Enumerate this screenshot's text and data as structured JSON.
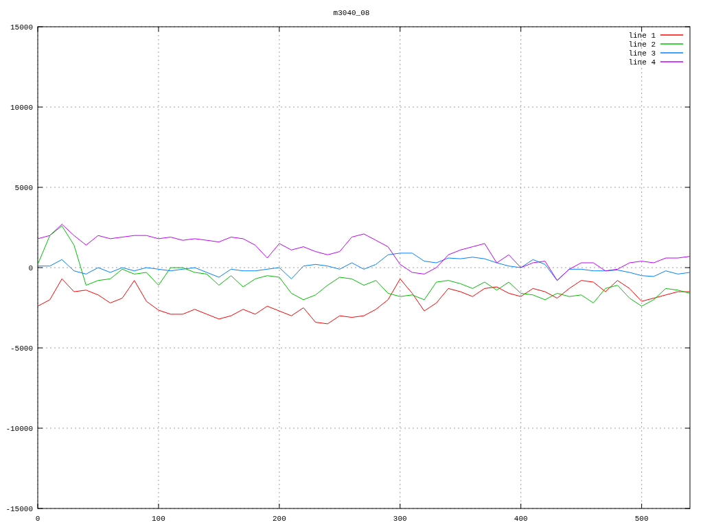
{
  "chart": {
    "chart_data": {
      "type": "line",
      "title": "m3040_08",
      "x": [
        0,
        10,
        20,
        30,
        40,
        50,
        60,
        70,
        80,
        90,
        100,
        110,
        120,
        130,
        140,
        150,
        160,
        170,
        180,
        190,
        200,
        210,
        220,
        230,
        240,
        250,
        260,
        270,
        280,
        290,
        300,
        310,
        320,
        330,
        340,
        350,
        360,
        370,
        380,
        390,
        400,
        410,
        420,
        430,
        440,
        450,
        460,
        470,
        480,
        490,
        500,
        510,
        520,
        530,
        540
      ],
      "series": [
        {
          "name": "line 1",
          "color": "#ff0000",
          "values": [
            -2400,
            -2000,
            -700,
            -1500,
            -1400,
            -1700,
            -2200,
            -1900,
            -800,
            -2100,
            -2650,
            -2900,
            -2900,
            -2600,
            -2900,
            -3200,
            -3000,
            -2600,
            -2900,
            -2400,
            -2700,
            -3000,
            -2500,
            -3400,
            -3500,
            -3000,
            -3100,
            -3000,
            -2600,
            -2000,
            -700,
            -1600,
            -2700,
            -2200,
            -1300,
            -1500,
            -1800,
            -1300,
            -1200,
            -1600,
            -1800,
            -1300,
            -1500,
            -1900,
            -1300,
            -800,
            -900,
            -1500,
            -800,
            -1300,
            -2100,
            -1900,
            -1700,
            -1500,
            -1500
          ]
        },
        {
          "name": "line 2",
          "color": "#00c000",
          "values": [
            200,
            2000,
            2600,
            1400,
            -1100,
            -800,
            -700,
            -100,
            -400,
            -300,
            -1100,
            0,
            0,
            -300,
            -400,
            -1100,
            -500,
            -1200,
            -700,
            -500,
            -600,
            -1600,
            -2000,
            -1700,
            -1100,
            -600,
            -700,
            -1100,
            -800,
            -1600,
            -1800,
            -1700,
            -2000,
            -900,
            -800,
            -1000,
            -1300,
            -900,
            -1400,
            -900,
            -1600,
            -1700,
            -2000,
            -1600,
            -1800,
            -1700,
            -2200,
            -1300,
            -1100,
            -1900,
            -2400,
            -2000,
            -1300,
            -1400,
            -1600
          ]
        },
        {
          "name": "line 3",
          "color": "#0080ff",
          "values": [
            100,
            100,
            500,
            -200,
            -400,
            0,
            -300,
            0,
            -200,
            0,
            -100,
            -200,
            -100,
            0,
            -300,
            -600,
            -100,
            -200,
            -200,
            -100,
            0,
            -700,
            100,
            200,
            100,
            -100,
            300,
            -100,
            200,
            800,
            900,
            900,
            400,
            300,
            600,
            550,
            650,
            550,
            300,
            100,
            0,
            500,
            200,
            -800,
            -100,
            -100,
            -200,
            -200,
            -150,
            -300,
            -500,
            -550,
            -200,
            -400,
            -300
          ]
        },
        {
          "name": "line 4",
          "color": "#c000ff",
          "values": [
            1800,
            2000,
            2700,
            2000,
            1400,
            2000,
            1800,
            1900,
            2000,
            2000,
            1800,
            1900,
            1700,
            1800,
            1700,
            1600,
            1900,
            1800,
            1400,
            600,
            1500,
            1100,
            1300,
            1000,
            800,
            1000,
            1900,
            2100,
            1700,
            1300,
            200,
            -300,
            -400,
            0,
            800,
            1100,
            1300,
            1500,
            300,
            800,
            0,
            300,
            400,
            -800,
            -100,
            300,
            300,
            -200,
            -100,
            300,
            400,
            300,
            600,
            600,
            700
          ]
        }
      ],
      "grid": true,
      "legend": true,
      "xlim": [
        0,
        540
      ],
      "ylim": [
        -15000,
        15000
      ],
      "xticks": [
        0,
        100,
        200,
        300,
        400,
        500
      ],
      "yticks": [
        -15000,
        -10000,
        -5000,
        0,
        5000,
        10000,
        15000
      ]
    }
  }
}
